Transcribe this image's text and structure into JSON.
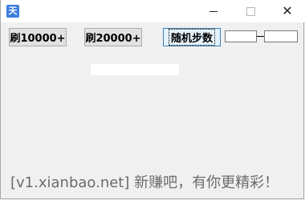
{
  "window": {
    "app_icon_glyph": "天",
    "app_icon_color": "#3b7ddd",
    "controls": {
      "close_glyph": "✕"
    }
  },
  "buttons": {
    "brush_10000": "刷10000+",
    "brush_20000": "刷20000+",
    "random_steps": "随机步数"
  },
  "range_inputs": {
    "min_value": "",
    "max_value": ""
  },
  "footer": {
    "text": "[v1.xianbao.net] 新赚吧，有你更精彩！"
  }
}
